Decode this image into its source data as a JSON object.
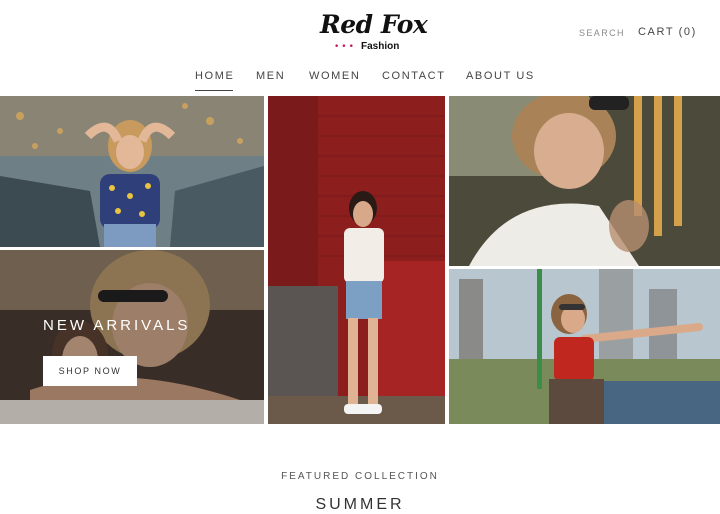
{
  "brand": {
    "logo_script": "Red Fox",
    "logo_sub": "Fashion",
    "logo_dots": "•••",
    "accent_color": "#c2185b"
  },
  "header": {
    "search_label": "SEARCH",
    "cart_label": "CART (0)"
  },
  "nav": {
    "items": [
      "HOME",
      "MEN",
      "WOMEN",
      "CONTACT",
      "ABOUT US"
    ],
    "active": "HOME"
  },
  "hero": {
    "title": "NEW ARRIVALS",
    "button_label": "SHOP NOW",
    "images": [
      "woman-rooftop-photo",
      "woman-brick-wall-photo",
      "man-sunglasses-photo",
      "couple-embrace-photo",
      "woman-pointing-photo"
    ]
  },
  "featured": {
    "label": "FEATURED COLLECTION",
    "title": "SUMMER"
  }
}
